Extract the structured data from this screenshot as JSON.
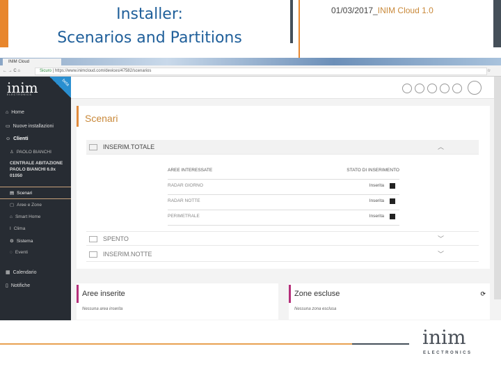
{
  "slide": {
    "title_line1": "Installer:",
    "title_line2": "Scenarios and Partitions",
    "date": "01/03/2017_",
    "product": "INIM Cloud 1.0",
    "footer_logo": "inim",
    "footer_logo_sub": "ELECTRONICS"
  },
  "browser": {
    "tab_title": "INIM Cloud",
    "secure": "Sicuro",
    "url": "https://www.inimcloud.com/devices/47582/scenarios"
  },
  "sidebar": {
    "logo": "inim",
    "logo_sub": "ELECTRONICS",
    "beta": "beta",
    "items": [
      {
        "label": "Home"
      },
      {
        "label": "Nuove installazioni"
      },
      {
        "label": "Clienti"
      },
      {
        "label": "PAOLO BIANCHI"
      },
      {
        "label": "CENTRALE ABITAZIONE PAOLO BIANCHI 6.0x 01050"
      },
      {
        "label": "Scenari"
      },
      {
        "label": "Aree e Zone"
      },
      {
        "label": "Smart Home"
      },
      {
        "label": "Clima"
      },
      {
        "label": "Sistema"
      },
      {
        "label": "Eventi"
      },
      {
        "label": "Calendario"
      },
      {
        "label": "Notifiche"
      }
    ]
  },
  "main": {
    "heading": "Scenari",
    "scenarios": [
      {
        "name": "INSERIM.TOTALE",
        "expanded": true
      },
      {
        "name": "SPENTO"
      },
      {
        "name": "INSERIM.NOTTE"
      }
    ],
    "col_areas": "AREE INTERESSATE",
    "col_state": "STATO DI INSERIMENTO",
    "rows": [
      {
        "area": "RADAR GIORNO",
        "state": "Inserita"
      },
      {
        "area": "RADAR NOTTE",
        "state": "Inserita"
      },
      {
        "area": "PERIMETRALE",
        "state": "Inserita"
      }
    ],
    "armed_title": "Aree inserite",
    "armed_empty": "Nessuna area inserita",
    "excluded_title": "Zone escluse",
    "excluded_empty": "Nessuna zona esclusa"
  },
  "colors": {
    "orange": "#e8862c",
    "dark": "#454f59",
    "blue": "#1f5f9a",
    "magenta": "#b52f7a"
  }
}
